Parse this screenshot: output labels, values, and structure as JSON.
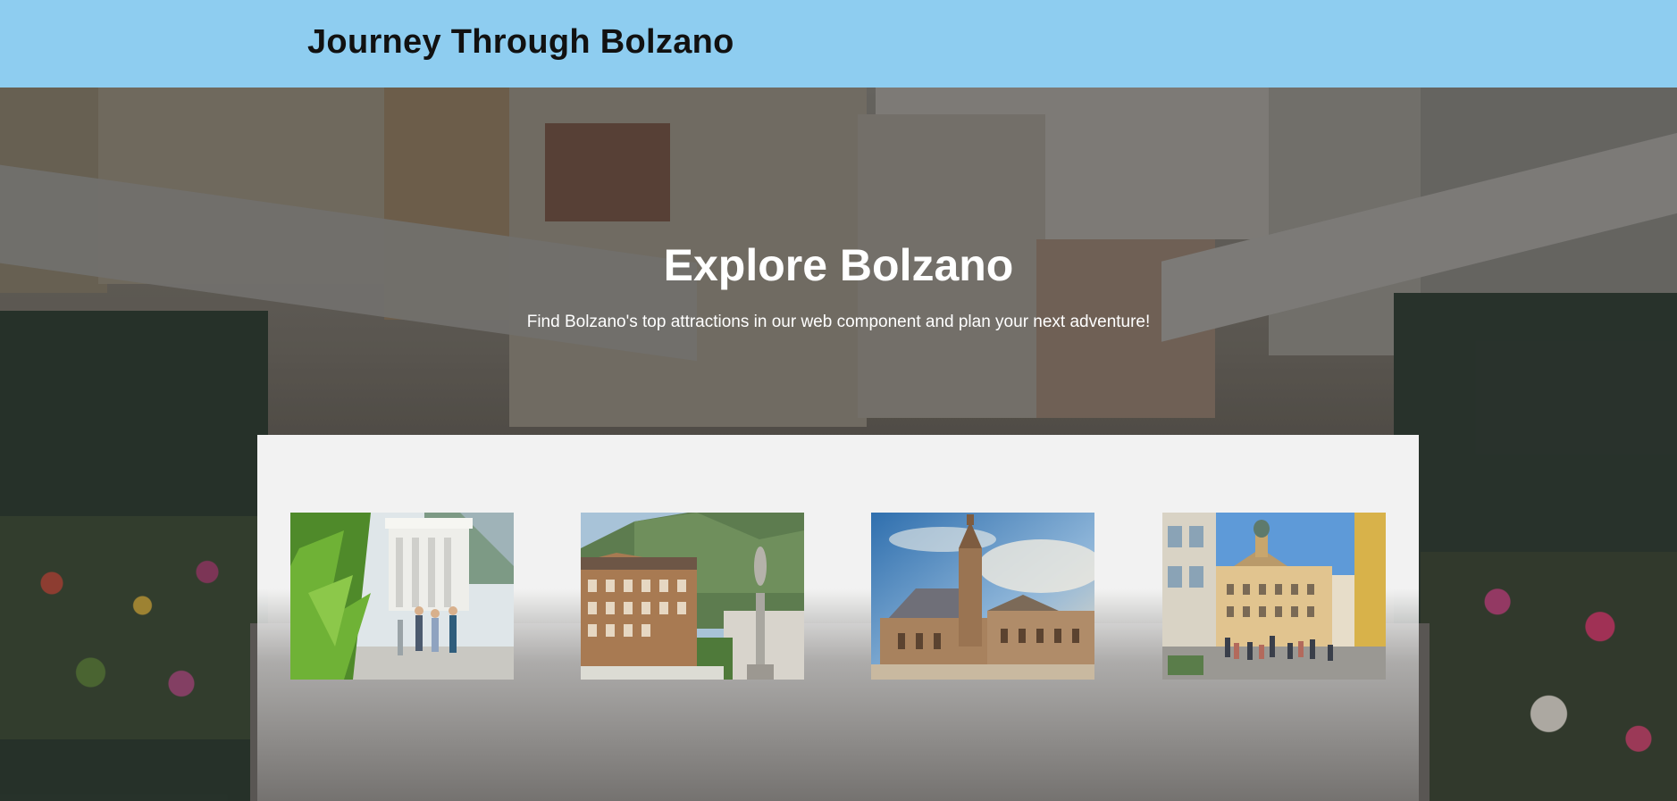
{
  "header": {
    "title": "Journey Through Bolzano",
    "background": "#8ecdf0"
  },
  "hero": {
    "title": "Explore Bolzano",
    "subtitle": "Find Bolzano's top attractions in our web component and plan your next adventure!"
  },
  "gallery": {
    "items": [
      {
        "icon": "victory-monument-photo"
      },
      {
        "icon": "walther-square-photo"
      },
      {
        "icon": "bolzano-cathedral-photo"
      },
      {
        "icon": "old-town-street-photo"
      }
    ]
  }
}
